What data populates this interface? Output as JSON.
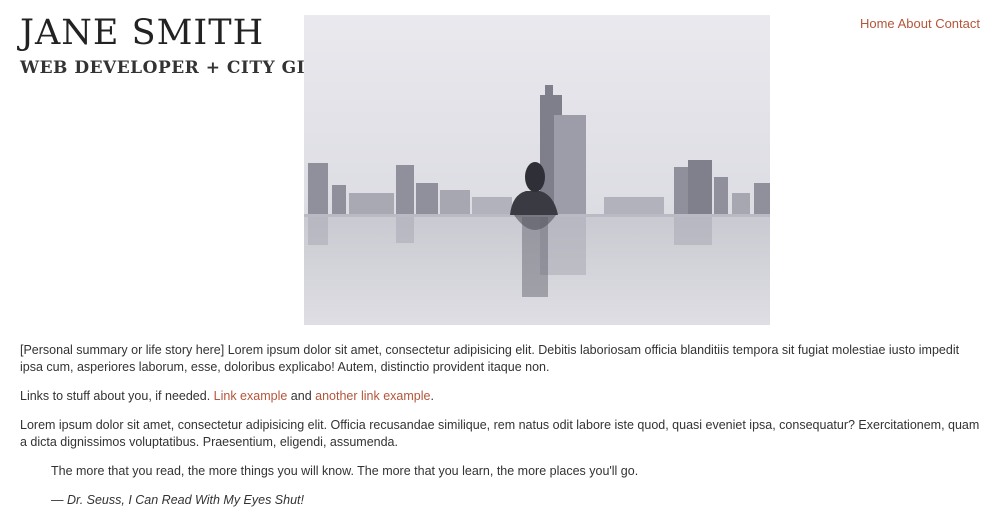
{
  "header": {
    "name": "JANE SMITH",
    "tagline": "WEB DEVELOPER + CITY GIRL"
  },
  "nav": {
    "items": [
      "Home",
      "About",
      "Contact"
    ]
  },
  "colors": {
    "accent": "#b5553a",
    "text": "#333333"
  },
  "content": {
    "summary": "[Personal summary or life story here] Lorem ipsum dolor sit amet, consectetur adipisicing elit. Debitis laboriosam officia blanditiis tempora sit fugiat molestiae iusto impedit ipsa cum, asperiores laborum, esse, doloribus explicabo! Autem, distinctio provident itaque non.",
    "links_intro": "Links to stuff about you, if needed. ",
    "link1": "Link example",
    "links_and": " and ",
    "link2": "another link example",
    "links_end": ".",
    "paragraph2": "Lorem ipsum dolor sit amet, consectetur adipisicing elit. Officia recusandae similique, rem natus odit labore iste quod, quasi eveniet ipsa, consequatur? Exercitationem, quam a dicta dignissimos voluptatibus. Praesentium, eligendi, assumenda.",
    "quote": "The more that you read, the more things you will know. The more that you learn, the more places you'll go.",
    "citation": "— Dr. Seuss, I Can Read With My Eyes Shut!"
  }
}
